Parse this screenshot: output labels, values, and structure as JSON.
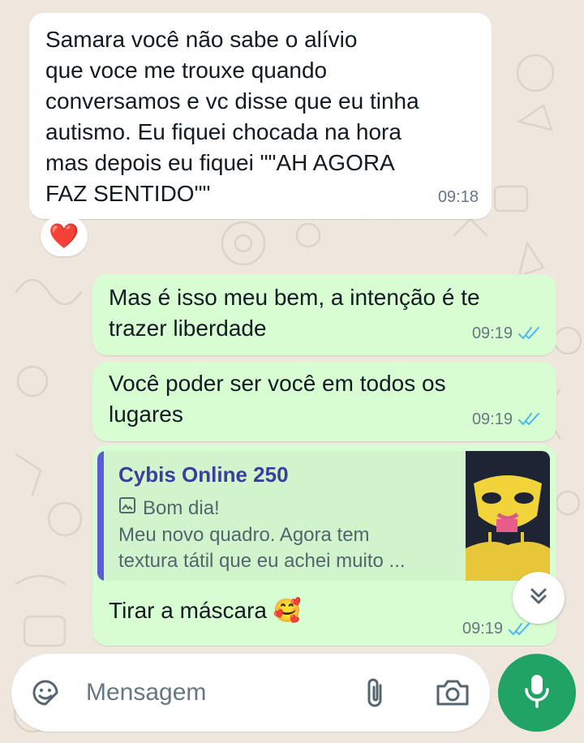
{
  "chat": {
    "messages": [
      {
        "direction": "incoming",
        "text": "Samara você não sabe o alívio\nque voce me trouxe quando\nconversamos e vc disse que eu tinha\nautismo. Eu fiquei chocada na hora\nmas depois eu fiquei \"\"AH AGORA\nFAZ SENTIDO\"\"",
        "time": "09:18",
        "reaction": "❤️"
      },
      {
        "direction": "outgoing",
        "text": "Mas é isso meu bem, a intenção é te\ntrazer liberdade",
        "time": "09:19",
        "status": "read"
      },
      {
        "direction": "outgoing",
        "text": "Você poder ser você em todos os\nlugares",
        "time": "09:19",
        "status": "read"
      },
      {
        "direction": "outgoing",
        "quote": {
          "author": "Cybis Online 250",
          "line1": "Bom dia!",
          "line2": "Meu novo quadro. Agora tem",
          "line3": "textura tátil que eu achei muito ...",
          "has_image": true
        },
        "text": "Tirar a máscara 🥰",
        "time": "09:19",
        "status": "read"
      }
    ]
  },
  "composer": {
    "placeholder": "Mensagem",
    "icons": [
      "sticker-icon",
      "attach-icon",
      "camera-icon",
      "mic-icon"
    ]
  },
  "colors": {
    "incoming_bubble": "#ffffff",
    "outgoing_bubble": "#d9fdd3",
    "read_ticks": "#53bdeb",
    "mic_button": "#21a366",
    "quote_bar": "#5b5bd6"
  }
}
